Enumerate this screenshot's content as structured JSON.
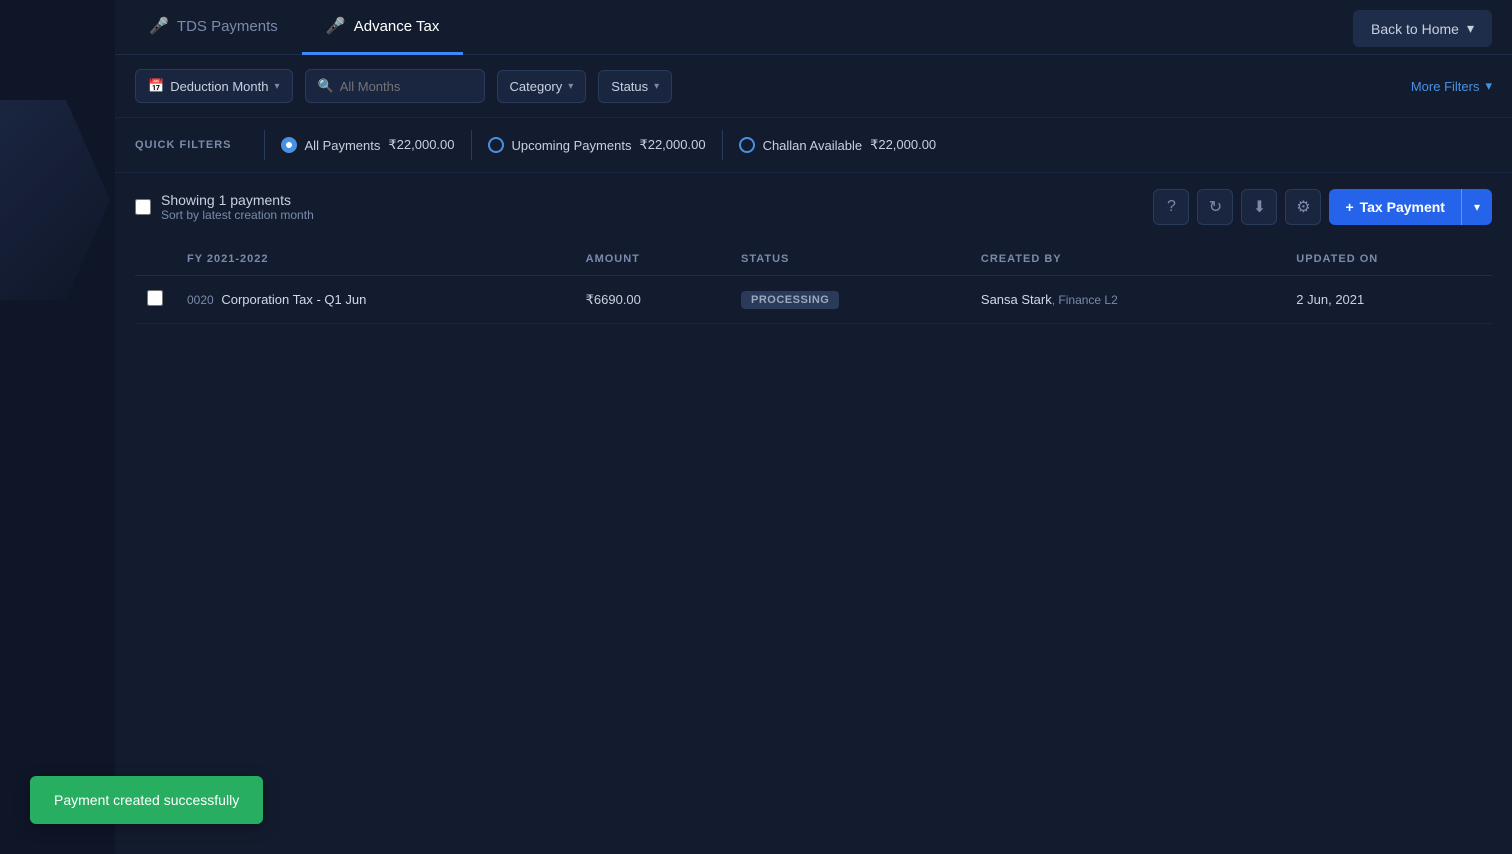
{
  "nav": {
    "back_label": "Back to Home"
  },
  "tabs": [
    {
      "id": "tds",
      "label": "TDS Payments",
      "active": false
    },
    {
      "id": "advance",
      "label": "Advance Tax",
      "active": true
    }
  ],
  "filters": {
    "deduction_month_label": "Deduction Month",
    "all_months_placeholder": "All Months",
    "category_label": "Category",
    "status_label": "Status",
    "more_filters_label": "More Filters"
  },
  "quick_filters": {
    "label": "QUICK FILTERS",
    "items": [
      {
        "id": "all",
        "label": "All Payments",
        "amount": "₹22,000.00",
        "active": true
      },
      {
        "id": "upcoming",
        "label": "Upcoming Payments",
        "amount": "₹22,000.00",
        "active": false
      },
      {
        "id": "challan",
        "label": "Challan Available",
        "amount": "₹22,000.00",
        "active": false
      }
    ]
  },
  "table": {
    "showing_label": "Showing 1 payments",
    "sort_label": "Sort by latest creation month",
    "columns": [
      "FY 2021-2022",
      "AMOUNT",
      "STATUS",
      "CREATED BY",
      "UPDATED ON"
    ],
    "rows": [
      {
        "num": "0020",
        "name": "Corporation Tax - Q1 Jun",
        "amount": "₹6690.00",
        "status": "PROCESSING",
        "created_by_name": "Sansa Stark",
        "created_by_role": "Finance L2",
        "updated_on": "2 Jun, 2021"
      }
    ],
    "add_button_label": "Tax Payment"
  },
  "toast": {
    "message": "Payment created successfully"
  }
}
